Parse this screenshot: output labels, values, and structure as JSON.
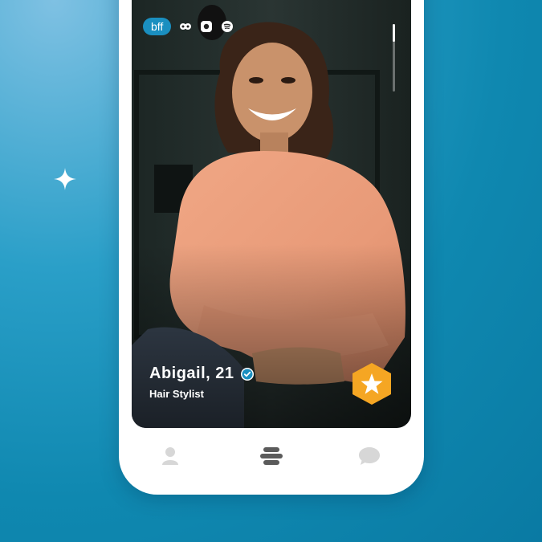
{
  "card": {
    "badge": "bff",
    "social_icons": [
      "eye-icon",
      "instagram-icon",
      "spotify-icon"
    ],
    "name_age": "Abigail, 21",
    "verified": true,
    "occupation": "Hair Stylist",
    "photo_count": 4,
    "current_photo": 1
  },
  "nav": {
    "items": [
      "profile-icon",
      "people-stack-icon",
      "chat-icon"
    ],
    "active": 1
  },
  "colors": {
    "background": "#0f88b0",
    "badge": "#1a8fc0",
    "superlike": "#f5a623",
    "verified": "#1a8fc0",
    "nav_inactive": "#d7d7d7",
    "nav_active": "#5b5b5b"
  }
}
